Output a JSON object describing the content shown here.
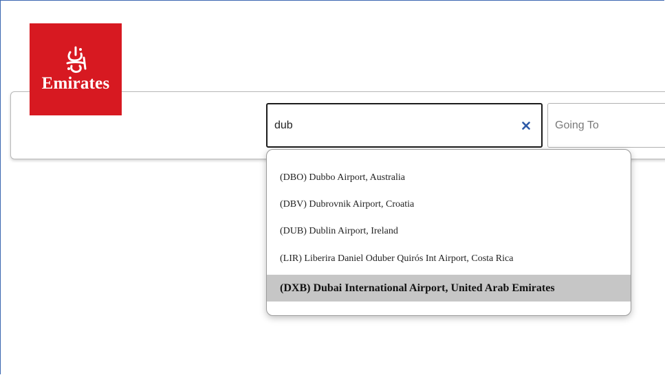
{
  "brand": {
    "name": "Emirates",
    "color": "#d71921"
  },
  "search": {
    "from_value": "dub",
    "to_placeholder": "Going To",
    "clear_icon": "close-icon"
  },
  "suggestions": [
    {
      "label": "(DBO) Dubbo Airport, Australia",
      "highlighted": false
    },
    {
      "label": "(DBV) Dubrovnik Airport, Croatia",
      "highlighted": false
    },
    {
      "label": "(DUB) Dublin Airport, Ireland",
      "highlighted": false
    },
    {
      "label": "(LIR) Liberira Daniel Oduber Quirós Int Airport, Costa Rica",
      "highlighted": false
    },
    {
      "label": "(DXB) Dubai International Airport, United Arab Emirates",
      "highlighted": true
    }
  ],
  "colors": {
    "highlight": "#c6c6c6",
    "accent_icon": "#2e5aa7"
  }
}
